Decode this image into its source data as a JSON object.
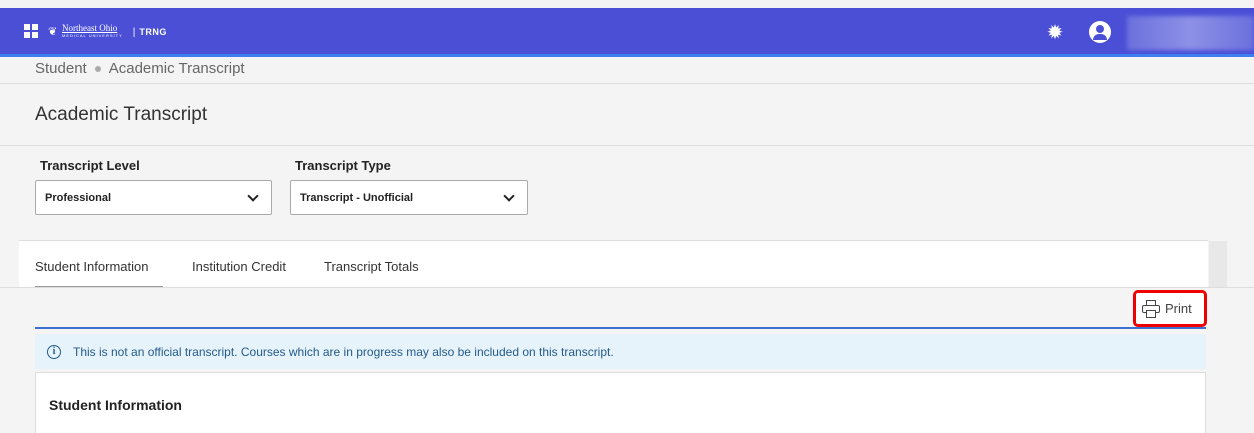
{
  "header": {
    "brand_line1": "Northeast Ohio",
    "brand_line2": "MEDICAL UNIVERSITY",
    "separator": "|",
    "environment": "TRNG",
    "accent_color": "#4a4fd6",
    "icons": [
      "grid-icon",
      "gear-icon",
      "user-icon"
    ]
  },
  "breadcrumb": [
    "Student",
    "Academic Transcript"
  ],
  "page": {
    "title": "Academic Transcript"
  },
  "filters": {
    "level_label": "Transcript Level",
    "level_value": "Professional",
    "type_label": "Transcript Type",
    "type_value": "Transcript - Unofficial"
  },
  "tabs": [
    "Student Information",
    "Institution Credit",
    "Transcript Totals"
  ],
  "active_tab": "Student Information",
  "actions": {
    "print_label": "Print"
  },
  "alert": {
    "text": "This is not an official transcript. Courses which are in progress may also be included on this transcript."
  },
  "section": {
    "title": "Student Information"
  }
}
